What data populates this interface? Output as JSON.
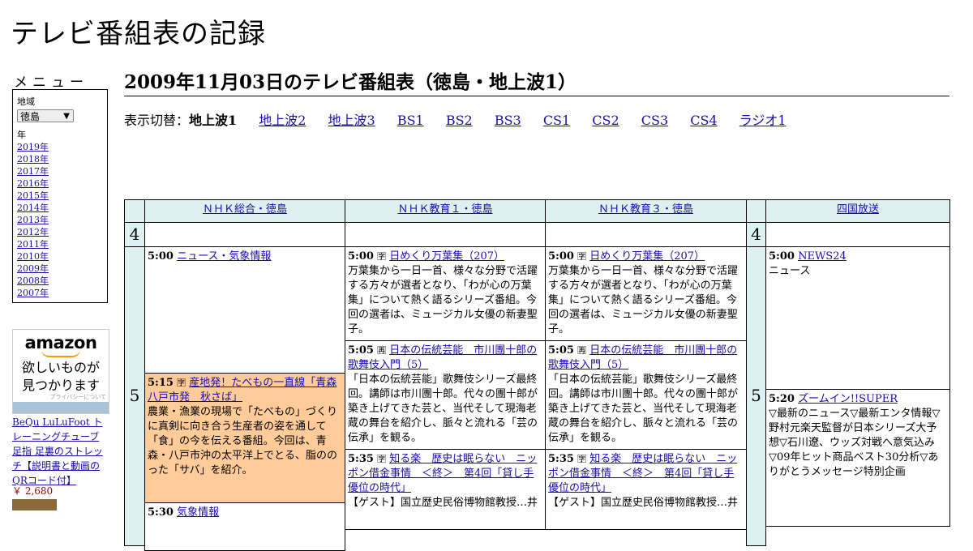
{
  "site_title": "テレビ番組表の記録",
  "menu": {
    "title": "メニュー",
    "region_label": "地域",
    "region_value": "徳島",
    "year_label": "年",
    "years": [
      "2019年",
      "2018年",
      "2017年",
      "2016年",
      "2015年",
      "2014年",
      "2013年",
      "2012年",
      "2011年",
      "2010年",
      "2009年",
      "2008年",
      "2007年"
    ]
  },
  "ad": {
    "logo": "amazon",
    "tagline_1": "欲しいものが",
    "tagline_2": "見つかります",
    "privacy": "プライバシーについて",
    "product": "BeQu LuLuFoot トレーニングチューブ 足指 足裏のストレッチ【説明書と動画のQRコード付】",
    "price": "￥ 2,680"
  },
  "page_title": "2009年11月03日のテレビ番組表（徳島・地上波1）",
  "switcher": {
    "label": "表示切替：",
    "current": "地上波1",
    "links": [
      "地上波2",
      "地上波3",
      "BS1",
      "BS2",
      "BS3",
      "CS1",
      "CS2",
      "CS3",
      "CS4",
      "ラジオ1"
    ]
  },
  "channels": [
    "ＮＨＫ総合・徳島",
    "ＮＨＫ教育１・徳島",
    "ＮＨＫ教育３・徳島",
    "四国放送"
  ],
  "hours": {
    "h4": "4",
    "h5": "5"
  },
  "programs": {
    "nhk_1": {
      "time": "5:00",
      "title": "ニュース・気象情報"
    },
    "nhk_2": {
      "time": "5:15",
      "title": "産地発！たべもの一直線「青森八戸市発　秋さば」",
      "desc": "農業・漁業の現場で「たべもの」づくりに真剣に向き合う生産者の姿を通して「食」の今を伝える番組。今回は、青森・八戸市沖の太平洋上でとる、脂ののった「サバ」を紹介。"
    },
    "nhk_3": {
      "time": "5:30",
      "title": "気象情報"
    },
    "e1_1": {
      "time": "5:00",
      "title": "日めくり万葉集（207）",
      "desc": "万葉集から一日一首、様々な分野で活躍する方々が選者となり、「わが心の万葉集」について熱く語るシリーズ番組。今回の選者は、ミュージカル女優の新妻聖子。"
    },
    "e1_2": {
      "time": "5:05",
      "title": "日本の伝統芸能　市川團十郎の歌舞伎入門（5）",
      "desc": "「日本の伝統芸能」歌舞伎シリーズ最終回。講師は市川團十郎。代々の團十郎が築き上げてきた芸と、当代そして現海老蔵の舞台を紹介し、脈々と流れる「芸の伝承」を観る。"
    },
    "e1_3": {
      "time": "5:35",
      "title": "知る楽　歴史は眠らない　ニッポン借金事情　＜終＞　第4回「貸し手優位の時代」",
      "desc": "【ゲスト】国立歴史民俗博物館教授…井"
    },
    "e3_1": {
      "time": "5:00",
      "title": "日めくり万葉集（207）",
      "desc": "万葉集から一日一首、様々な分野で活躍する方々が選者となり、「わが心の万葉集」について熱く語るシリーズ番組。今回の選者は、ミュージカル女優の新妻聖子。"
    },
    "e3_2": {
      "time": "5:05",
      "title": "日本の伝統芸能　市川團十郎の歌舞伎入門（5）",
      "desc": "「日本の伝統芸能」歌舞伎シリーズ最終回。講師は市川團十郎。代々の團十郎が築き上げてきた芸と、当代そして現海老蔵の舞台を紹介し、脈々と流れる「芸の伝承」を観る。"
    },
    "e3_3": {
      "time": "5:35",
      "title": "知る楽　歴史は眠らない　ニッポン借金事情　＜終＞　第4回「貸し手優位の時代」",
      "desc": "【ゲスト】国立歴史民俗博物館教授…井"
    },
    "jrt_1": {
      "time": "5:00",
      "title": "NEWS24",
      "desc": "ニュース"
    },
    "jrt_2": {
      "time": "5:20",
      "title": "ズームイン!!SUPER",
      "desc": "▽最新のニュース▽最新エンタ情報▽野村元楽天監督が日本シリーズ大予想▽石川遼、ウッズ対戦へ意気込み▽09年ヒット商品ベスト30分析▽ありがとうメッセージ特別企画"
    }
  },
  "colors": {
    "header_bg": "#dff0f0",
    "highlight_bg": "#ffcc99",
    "link": "#1a0dab"
  }
}
